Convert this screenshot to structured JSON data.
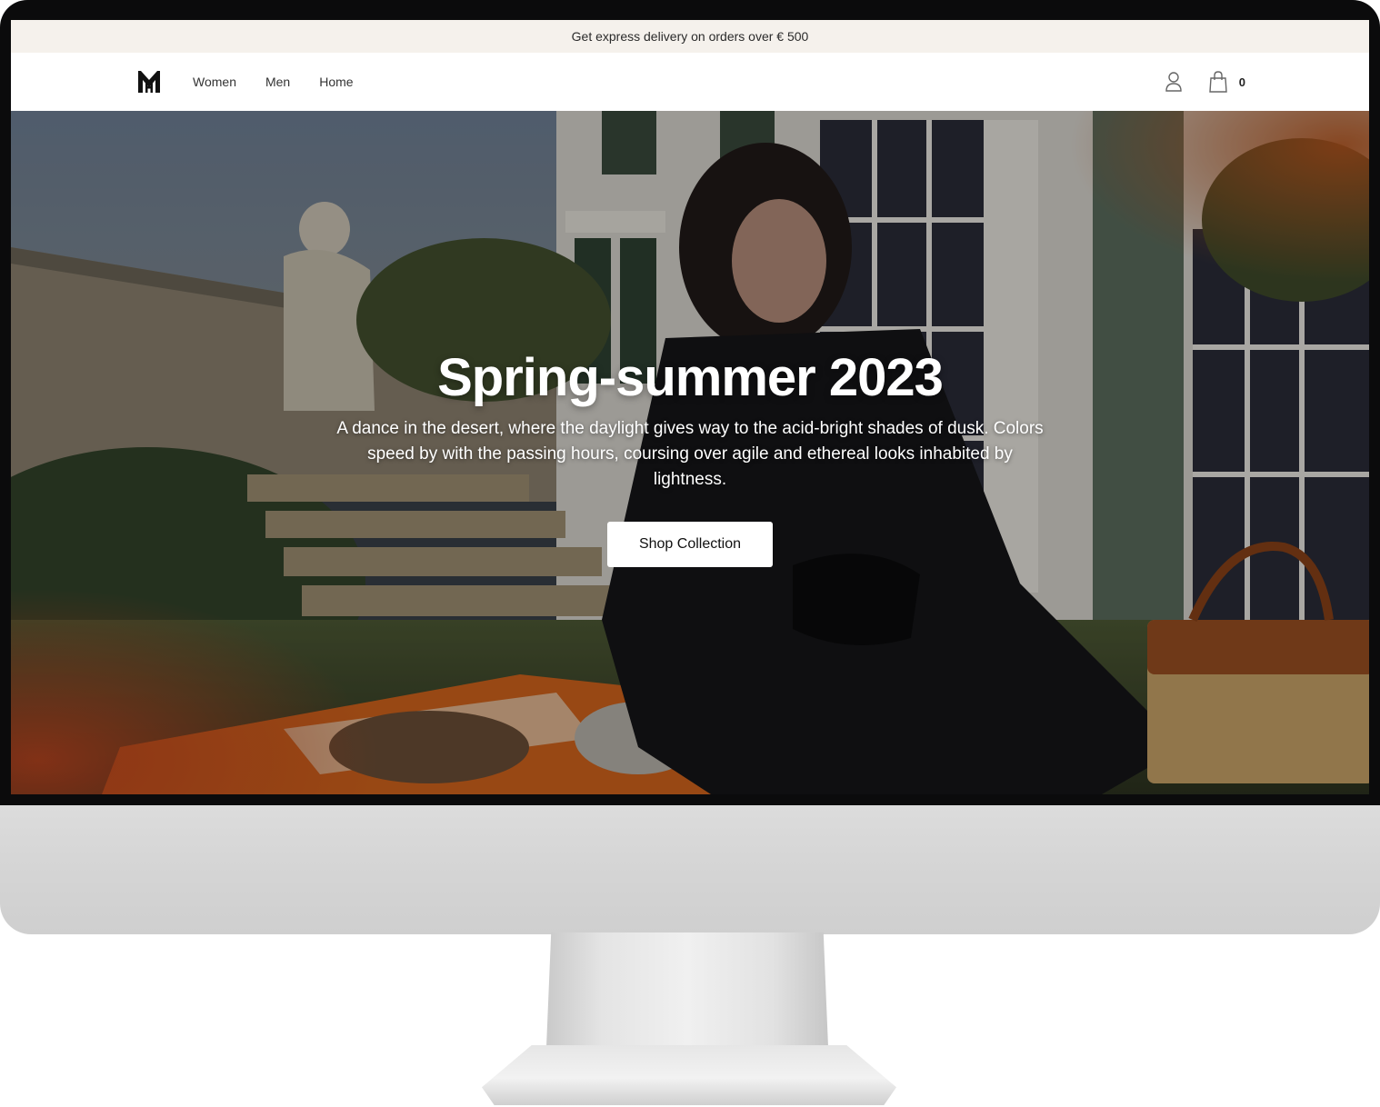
{
  "announcement": {
    "text": "Get express delivery on orders over € 500"
  },
  "nav": {
    "logo": "logo-mh-icon",
    "links": [
      {
        "label": "Women"
      },
      {
        "label": "Men"
      },
      {
        "label": "Home"
      }
    ],
    "account_icon": "user-icon",
    "cart_icon": "shopping-bag-icon",
    "cart_count": "0"
  },
  "hero": {
    "title": "Spring-summer 2023",
    "description": "A dance in the desert, where the daylight gives way to the acid-bright shades of dusk. Colors speed by with the passing hours, coursing over agile and ethereal looks inhabited by lightness.",
    "cta_label": "Shop Collection"
  },
  "colors": {
    "announcement_bg": "#f5f1ec",
    "cta_bg": "#ffffff",
    "text_dark": "#2b2b2b"
  }
}
